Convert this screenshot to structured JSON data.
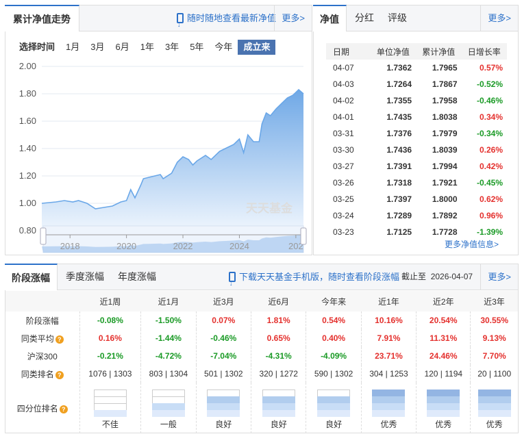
{
  "left": {
    "tab": "累计净值走势",
    "promo": "随时随地查看最新净值",
    "more": "更多>",
    "period_label": "选择时间",
    "periods": [
      "1月",
      "3月",
      "6月",
      "1年",
      "3年",
      "5年",
      "今年",
      "成立来"
    ],
    "active_period": "成立来"
  },
  "chart_data": {
    "type": "area",
    "title": "累计净值走势",
    "ylim": [
      0.8,
      2.0
    ],
    "yticks": [
      "2.00",
      "1.80",
      "1.60",
      "1.40",
      "1.20",
      "1.00",
      "0.80"
    ],
    "xticks": [
      "2018",
      "2020",
      "2022",
      "2024",
      "202"
    ],
    "xlim": [
      2017.0,
      2026.27
    ],
    "x": [
      2017.0,
      2017.5,
      2017.8,
      2018.1,
      2018.3,
      2018.6,
      2018.9,
      2019.2,
      2019.5,
      2019.8,
      2020.0,
      2020.15,
      2020.3,
      2020.5,
      2020.6,
      2020.8,
      2021.2,
      2021.3,
      2021.6,
      2021.8,
      2022.0,
      2022.2,
      2022.35,
      2022.5,
      2022.8,
      2023.0,
      2023.3,
      2023.5,
      2023.8,
      2024.0,
      2024.15,
      2024.3,
      2024.5,
      2024.7,
      2024.8,
      2024.95,
      2025.1,
      2025.3,
      2025.5,
      2025.7,
      2025.9,
      2026.1,
      2026.27
    ],
    "y": [
      1.0,
      1.01,
      1.02,
      1.01,
      1.02,
      1.0,
      0.96,
      0.97,
      0.98,
      1.01,
      1.02,
      1.1,
      1.04,
      1.13,
      1.18,
      1.19,
      1.21,
      1.18,
      1.22,
      1.3,
      1.34,
      1.32,
      1.28,
      1.31,
      1.35,
      1.32,
      1.38,
      1.4,
      1.43,
      1.47,
      1.37,
      1.5,
      1.45,
      1.45,
      1.58,
      1.66,
      1.64,
      1.69,
      1.73,
      1.77,
      1.79,
      1.83,
      1.8
    ],
    "watermark": "天天基金"
  },
  "right": {
    "tabs": [
      "净值",
      "分红",
      "评级"
    ],
    "more": "更多>",
    "headers": [
      "日期",
      "单位净值",
      "累计净值",
      "日增长率"
    ],
    "rows": [
      [
        "04-07",
        "1.7362",
        "1.7965",
        "0.57%"
      ],
      [
        "04-03",
        "1.7264",
        "1.7867",
        "-0.52%"
      ],
      [
        "04-02",
        "1.7355",
        "1.7958",
        "-0.46%"
      ],
      [
        "04-01",
        "1.7435",
        "1.8038",
        "0.34%"
      ],
      [
        "03-31",
        "1.7376",
        "1.7979",
        "-0.34%"
      ],
      [
        "03-30",
        "1.7436",
        "1.8039",
        "0.26%"
      ],
      [
        "03-27",
        "1.7391",
        "1.7994",
        "0.42%"
      ],
      [
        "03-26",
        "1.7318",
        "1.7921",
        "-0.45%"
      ],
      [
        "03-25",
        "1.7397",
        "1.8000",
        "0.62%"
      ],
      [
        "03-24",
        "1.7289",
        "1.7892",
        "0.96%"
      ],
      [
        "03-23",
        "1.7125",
        "1.7728",
        "-1.39%"
      ]
    ],
    "more_link": "更多净值信息>"
  },
  "bottom": {
    "tabs": [
      "阶段涨幅",
      "季度涨幅",
      "年度涨幅"
    ],
    "promo": "下载天天基金手机版，随时查看阶段涨幅",
    "as_of_label": "截止至",
    "as_of": "2026-04-07",
    "more": "更多>",
    "headers": [
      "近1周",
      "近1月",
      "近3月",
      "近6月",
      "今年来",
      "近1年",
      "近2年",
      "近3年"
    ],
    "rows": [
      {
        "label": "阶段涨幅",
        "q": false,
        "values": [
          "-0.08%",
          "-1.50%",
          "0.07%",
          "1.81%",
          "0.54%",
          "10.16%",
          "20.54%",
          "30.55%"
        ]
      },
      {
        "label": "同类平均",
        "q": true,
        "values": [
          "0.16%",
          "-1.44%",
          "-0.46%",
          "0.65%",
          "0.40%",
          "7.91%",
          "11.31%",
          "9.13%"
        ]
      },
      {
        "label": "沪深300",
        "q": false,
        "values": [
          "-0.21%",
          "-4.72%",
          "-7.04%",
          "-4.31%",
          "-4.09%",
          "23.71%",
          "24.46%",
          "7.70%"
        ]
      }
    ],
    "rank_label": "同类排名",
    "ranks": [
      "1076 | 1303",
      "803 | 1304",
      "501 | 1302",
      "320 | 1272",
      "590 | 1302",
      "304 | 1253",
      "120 | 1194",
      "20 | 1100"
    ],
    "quartile_label": "四分位排名",
    "quartile_levels": [
      1,
      2,
      3,
      3,
      3,
      4,
      4,
      4
    ],
    "quartiles": [
      "不佳",
      "一般",
      "良好",
      "良好",
      "良好",
      "优秀",
      "优秀",
      "优秀"
    ]
  }
}
